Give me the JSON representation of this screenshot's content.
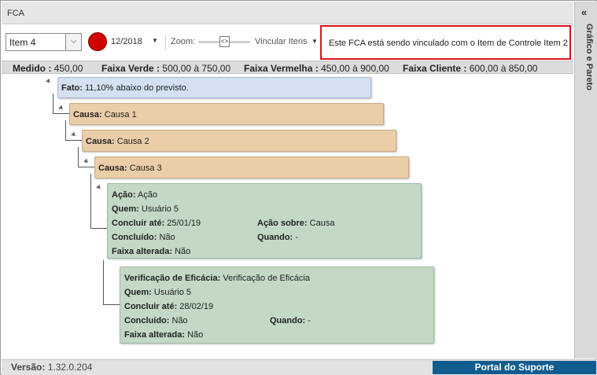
{
  "window": {
    "title": "FCA"
  },
  "side_panel": {
    "label": "Gráfico e Pareto"
  },
  "toolbar": {
    "item_select": "Item 4",
    "status_color": "#d00000",
    "period": "12/2018",
    "zoom_label": "Zoom:",
    "link_items_label": "Vincular Itens",
    "notice": "Este FCA está sendo vinculado com o Item de Controle Item 2"
  },
  "ranges": {
    "medido_label": "Medido :",
    "medido_value": "450,00",
    "verde_label": "Faixa Verde :",
    "verde_value": "500,00 à 750,00",
    "vermelha_label": "Faixa Vermelha :",
    "vermelha_value": "450,00 à 900,00",
    "cliente_label": "Faixa Cliente :",
    "cliente_value": "600,00 à 850,00"
  },
  "tree": {
    "fact": {
      "label": "Fato:",
      "text": "11,10% abaixo do previsto."
    },
    "causes": [
      {
        "label": "Causa:",
        "text": "Causa 1"
      },
      {
        "label": "Causa:",
        "text": "Causa 2"
      },
      {
        "label": "Causa:",
        "text": "Causa 3"
      }
    ],
    "action": {
      "acao_label": "Ação:",
      "acao_value": "Ação",
      "quem_label": "Quem:",
      "quem_value": "Usuário 5",
      "concluir_label": "Concluir até:",
      "concluir_value": "25/01/19",
      "sobre_label": "Ação sobre:",
      "sobre_value": "Causa",
      "concluido_label": "Concluído:",
      "concluido_value": "Não",
      "quando_label": "Quando:",
      "quando_value": "-",
      "faixa_label": "Faixa alterada:",
      "faixa_value": "Não"
    },
    "verification": {
      "verif_label": "Verificação de Eficácia:",
      "verif_value": "Verificação de Eficácia",
      "quem_label": "Quem:",
      "quem_value": "Usuário 5",
      "concluir_label": "Concluir até:",
      "concluir_value": "28/02/19",
      "concluido_label": "Concluído:",
      "concluido_value": "Não",
      "quando_label": "Quando:",
      "quando_value": "-",
      "faixa_label": "Faixa alterada:",
      "faixa_value": "Não"
    }
  },
  "footer": {
    "version_label": "Versão:",
    "version_value": "1.32.0.204",
    "portal_button": "Portal do Suporte",
    "portal_color": "#115c8f"
  }
}
